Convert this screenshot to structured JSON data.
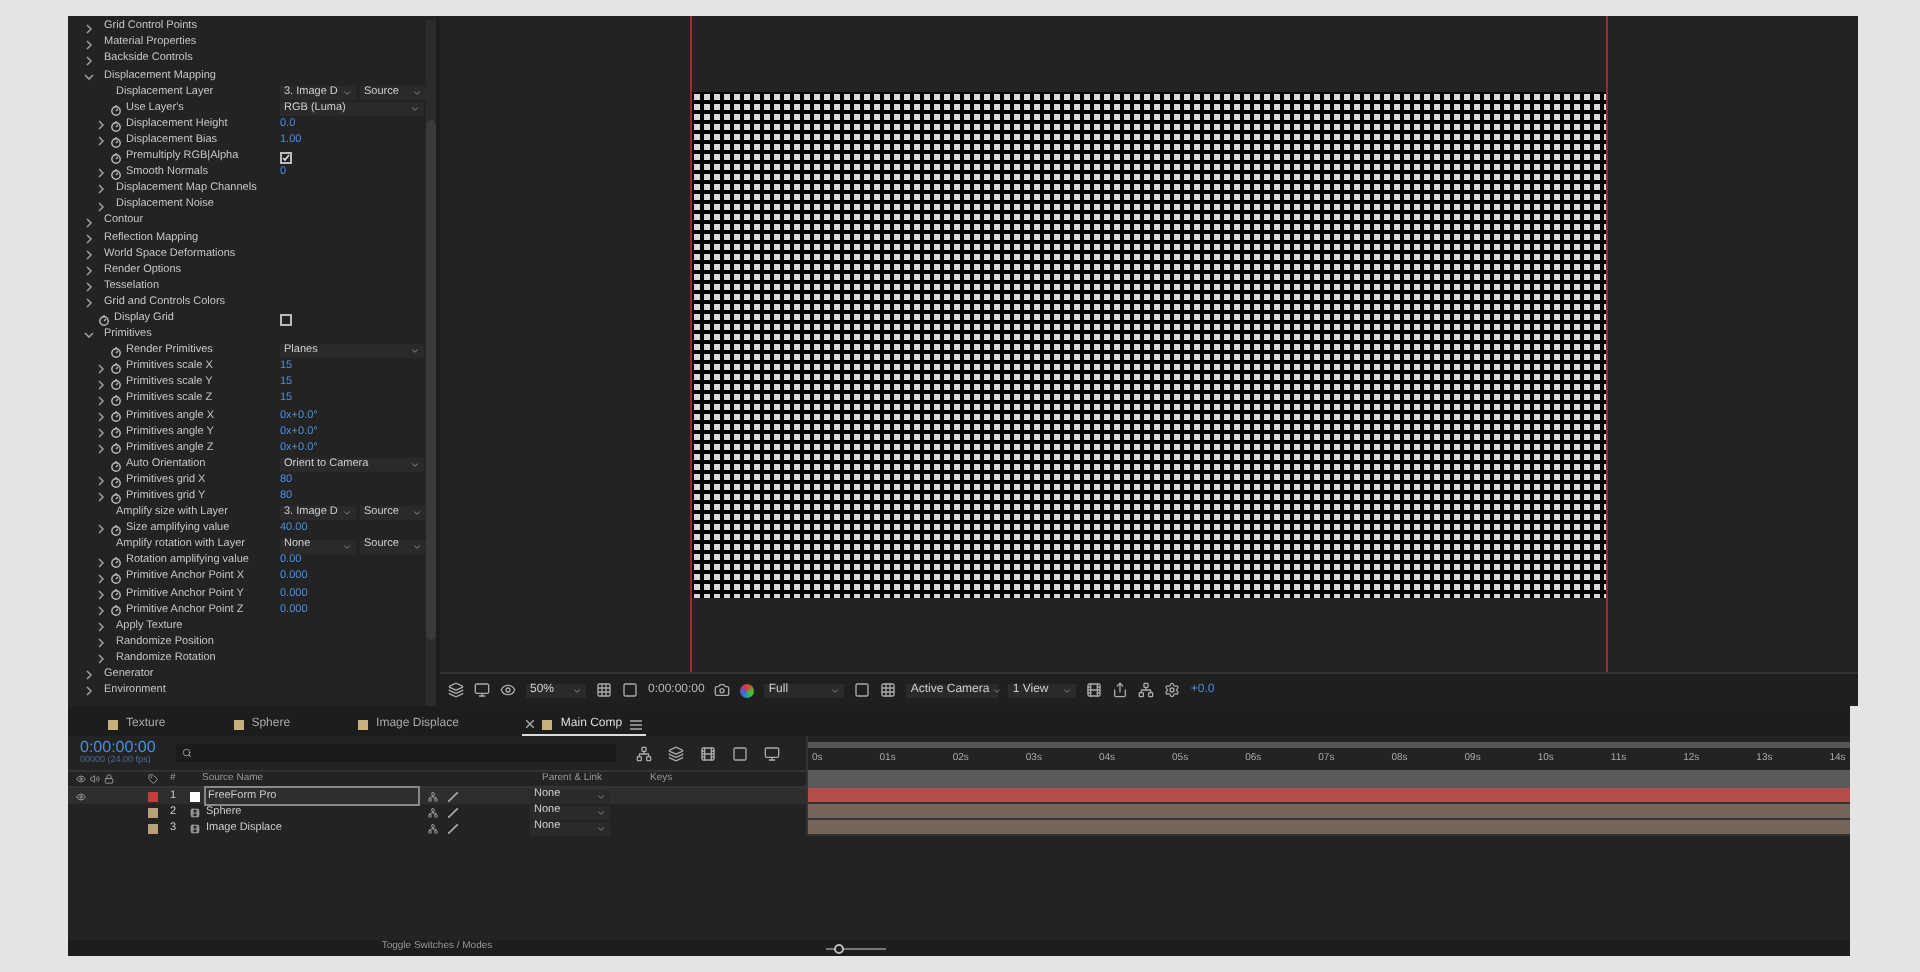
{
  "effect_controls": [
    {
      "label": "Grid Control Points",
      "expandable": true,
      "expanded": false,
      "stopwatch": false
    },
    {
      "label": "Material Properties",
      "expandable": true,
      "expanded": false,
      "stopwatch": false
    },
    {
      "label": "Backside Controls",
      "expandable": true,
      "expanded": false,
      "stopwatch": false
    },
    {
      "label": "Displacement Mapping",
      "expandable": true,
      "expanded": true,
      "stopwatch": false,
      "children": [
        {
          "label": "Displacement Layer",
          "expandable": false,
          "stopwatch": false,
          "control": {
            "kind": "dropdown_pair",
            "value": "3. Image D",
            "value_2": "Source"
          }
        },
        {
          "label": "Use Layer's",
          "expandable": false,
          "stopwatch": true,
          "control": {
            "kind": "dropdown",
            "value": "RGB (Luma)"
          }
        },
        {
          "label": "Displacement Height",
          "expandable": true,
          "expanded": false,
          "stopwatch": true,
          "control": {
            "kind": "number",
            "value": "0.0"
          }
        },
        {
          "label": "Displacement Bias",
          "expandable": true,
          "expanded": false,
          "stopwatch": true,
          "control": {
            "kind": "number",
            "value": "1.00"
          }
        },
        {
          "label": "Premultiply RGB|Alpha",
          "expandable": false,
          "stopwatch": true,
          "control": {
            "kind": "checkbox",
            "checked": true
          }
        },
        {
          "label": "Smooth Normals",
          "expandable": true,
          "expanded": false,
          "stopwatch": true,
          "control": {
            "kind": "number",
            "value": "0"
          }
        },
        {
          "label": "Displacement Map Channels",
          "expandable": true,
          "expanded": false,
          "stopwatch": false
        },
        {
          "label": "Displacement Noise",
          "expandable": true,
          "expanded": false,
          "stopwatch": false
        }
      ]
    },
    {
      "label": "Contour",
      "expandable": true,
      "expanded": false,
      "stopwatch": false
    },
    {
      "label": "Reflection Mapping",
      "expandable": true,
      "expanded": false,
      "stopwatch": false
    },
    {
      "label": "World Space Deformations",
      "expandable": true,
      "expanded": false,
      "stopwatch": false
    },
    {
      "label": "Render Options",
      "expandable": true,
      "expanded": false,
      "stopwatch": false
    },
    {
      "label": "Tesselation",
      "expandable": true,
      "expanded": false,
      "stopwatch": false
    },
    {
      "label": "Grid and Controls Colors",
      "expandable": true,
      "expanded": false,
      "stopwatch": false
    },
    {
      "label": "Display Grid",
      "expandable": false,
      "stopwatch": true,
      "control": {
        "kind": "checkbox",
        "checked": false
      }
    },
    {
      "label": "Primitives",
      "expandable": true,
      "expanded": true,
      "stopwatch": false,
      "children": [
        {
          "label": "Render Primitives",
          "expandable": false,
          "stopwatch": true,
          "control": {
            "kind": "dropdown",
            "value": "Planes"
          }
        },
        {
          "label": "Primitives scale X",
          "expandable": true,
          "expanded": false,
          "stopwatch": true,
          "control": {
            "kind": "number",
            "value": "15"
          }
        },
        {
          "label": "Primitives scale Y",
          "expandable": true,
          "expanded": false,
          "stopwatch": true,
          "control": {
            "kind": "number",
            "value": "15"
          }
        },
        {
          "label": "Primitives scale Z",
          "expandable": true,
          "expanded": false,
          "stopwatch": true,
          "control": {
            "kind": "number",
            "value": "15"
          }
        },
        {
          "label": "Primitives angle X",
          "expandable": true,
          "expanded": false,
          "stopwatch": true,
          "control": {
            "kind": "number",
            "value": "0x+0.0°"
          }
        },
        {
          "label": "Primitives angle Y",
          "expandable": true,
          "expanded": false,
          "stopwatch": true,
          "control": {
            "kind": "number",
            "value": "0x+0.0°"
          }
        },
        {
          "label": "Primitives angle Z",
          "expandable": true,
          "expanded": false,
          "stopwatch": true,
          "control": {
            "kind": "number",
            "value": "0x+0.0°"
          }
        },
        {
          "label": "Auto Orientation",
          "expandable": false,
          "stopwatch": true,
          "control": {
            "kind": "dropdown",
            "value": "Orient to Camera"
          }
        },
        {
          "label": "Primitives grid X",
          "expandable": true,
          "expanded": false,
          "stopwatch": true,
          "control": {
            "kind": "number",
            "value": "80"
          }
        },
        {
          "label": "Primitives grid Y",
          "expandable": true,
          "expanded": false,
          "stopwatch": true,
          "control": {
            "kind": "number",
            "value": "80"
          }
        },
        {
          "label": "Amplify size with Layer",
          "expandable": false,
          "stopwatch": false,
          "control": {
            "kind": "dropdown_pair",
            "value": "3. Image D",
            "value_2": "Source"
          }
        },
        {
          "label": "Size amplifying value",
          "expandable": true,
          "expanded": false,
          "stopwatch": true,
          "control": {
            "kind": "number",
            "value": "40.00"
          }
        },
        {
          "label": "Amplify rotation with Layer",
          "expandable": false,
          "stopwatch": false,
          "control": {
            "kind": "dropdown_pair",
            "value": "None",
            "value_2": "Source"
          }
        },
        {
          "label": "Rotation amplifying value",
          "expandable": true,
          "expanded": false,
          "stopwatch": true,
          "control": {
            "kind": "number",
            "value": "0.00"
          }
        },
        {
          "label": "Primitive Anchor Point X",
          "expandable": true,
          "expanded": false,
          "stopwatch": true,
          "control": {
            "kind": "number",
            "value": "0.000"
          }
        },
        {
          "label": "Primitive Anchor Point Y",
          "expandable": true,
          "expanded": false,
          "stopwatch": true,
          "control": {
            "kind": "number",
            "value": "0.000"
          }
        },
        {
          "label": "Primitive Anchor Point Z",
          "expandable": true,
          "expanded": false,
          "stopwatch": true,
          "control": {
            "kind": "number",
            "value": "0.000"
          }
        },
        {
          "label": "Apply Texture",
          "expandable": true,
          "expanded": false,
          "stopwatch": false
        },
        {
          "label": "Randomize Position",
          "expandable": true,
          "expanded": false,
          "stopwatch": false
        },
        {
          "label": "Randomize Rotation",
          "expandable": true,
          "expanded": false,
          "stopwatch": false
        }
      ]
    },
    {
      "label": "Generator",
      "expandable": true,
      "expanded": false,
      "stopwatch": false
    },
    {
      "label": "Environment",
      "expandable": true,
      "expanded": false,
      "stopwatch": false
    }
  ],
  "viewer_toolbar": {
    "zoom": "50%",
    "timecode": "0:00:00:00",
    "resolution": "Full",
    "camera": "Active Camera",
    "views": "1 View",
    "exposure": "+0.0"
  },
  "timeline": {
    "tabs": [
      {
        "label": "Texture",
        "selected": false
      },
      {
        "label": "Sphere",
        "selected": false
      },
      {
        "label": "Image Displace",
        "selected": false
      },
      {
        "label": "Main Comp",
        "selected": true
      }
    ],
    "current_time": "0:00:00:00",
    "frame_info": "00000 (24.00 fps)",
    "columns": {
      "number": "#",
      "source_name": "Source Name",
      "parent": "Parent & Link",
      "keys": "Keys"
    },
    "layers": [
      {
        "number": "1",
        "name": "FreeForm Pro",
        "color": "#c0403c",
        "selected": true,
        "kind": "solid",
        "parent": "None"
      },
      {
        "number": "2",
        "name": "Sphere",
        "color": "#b8a07a",
        "selected": false,
        "kind": "footage",
        "parent": "None"
      },
      {
        "number": "3",
        "name": "Image Displace",
        "color": "#b8a07a",
        "selected": false,
        "kind": "footage",
        "parent": "None"
      }
    ],
    "ruler": [
      "0s",
      "01s",
      "02s",
      "03s",
      "04s",
      "05s",
      "06s",
      "07s",
      "08s",
      "09s",
      "10s",
      "11s",
      "12s",
      "13s",
      "14s"
    ],
    "toggle_label": "Toggle Switches / Modes",
    "zoom_slider": {
      "level": 0.15
    }
  }
}
